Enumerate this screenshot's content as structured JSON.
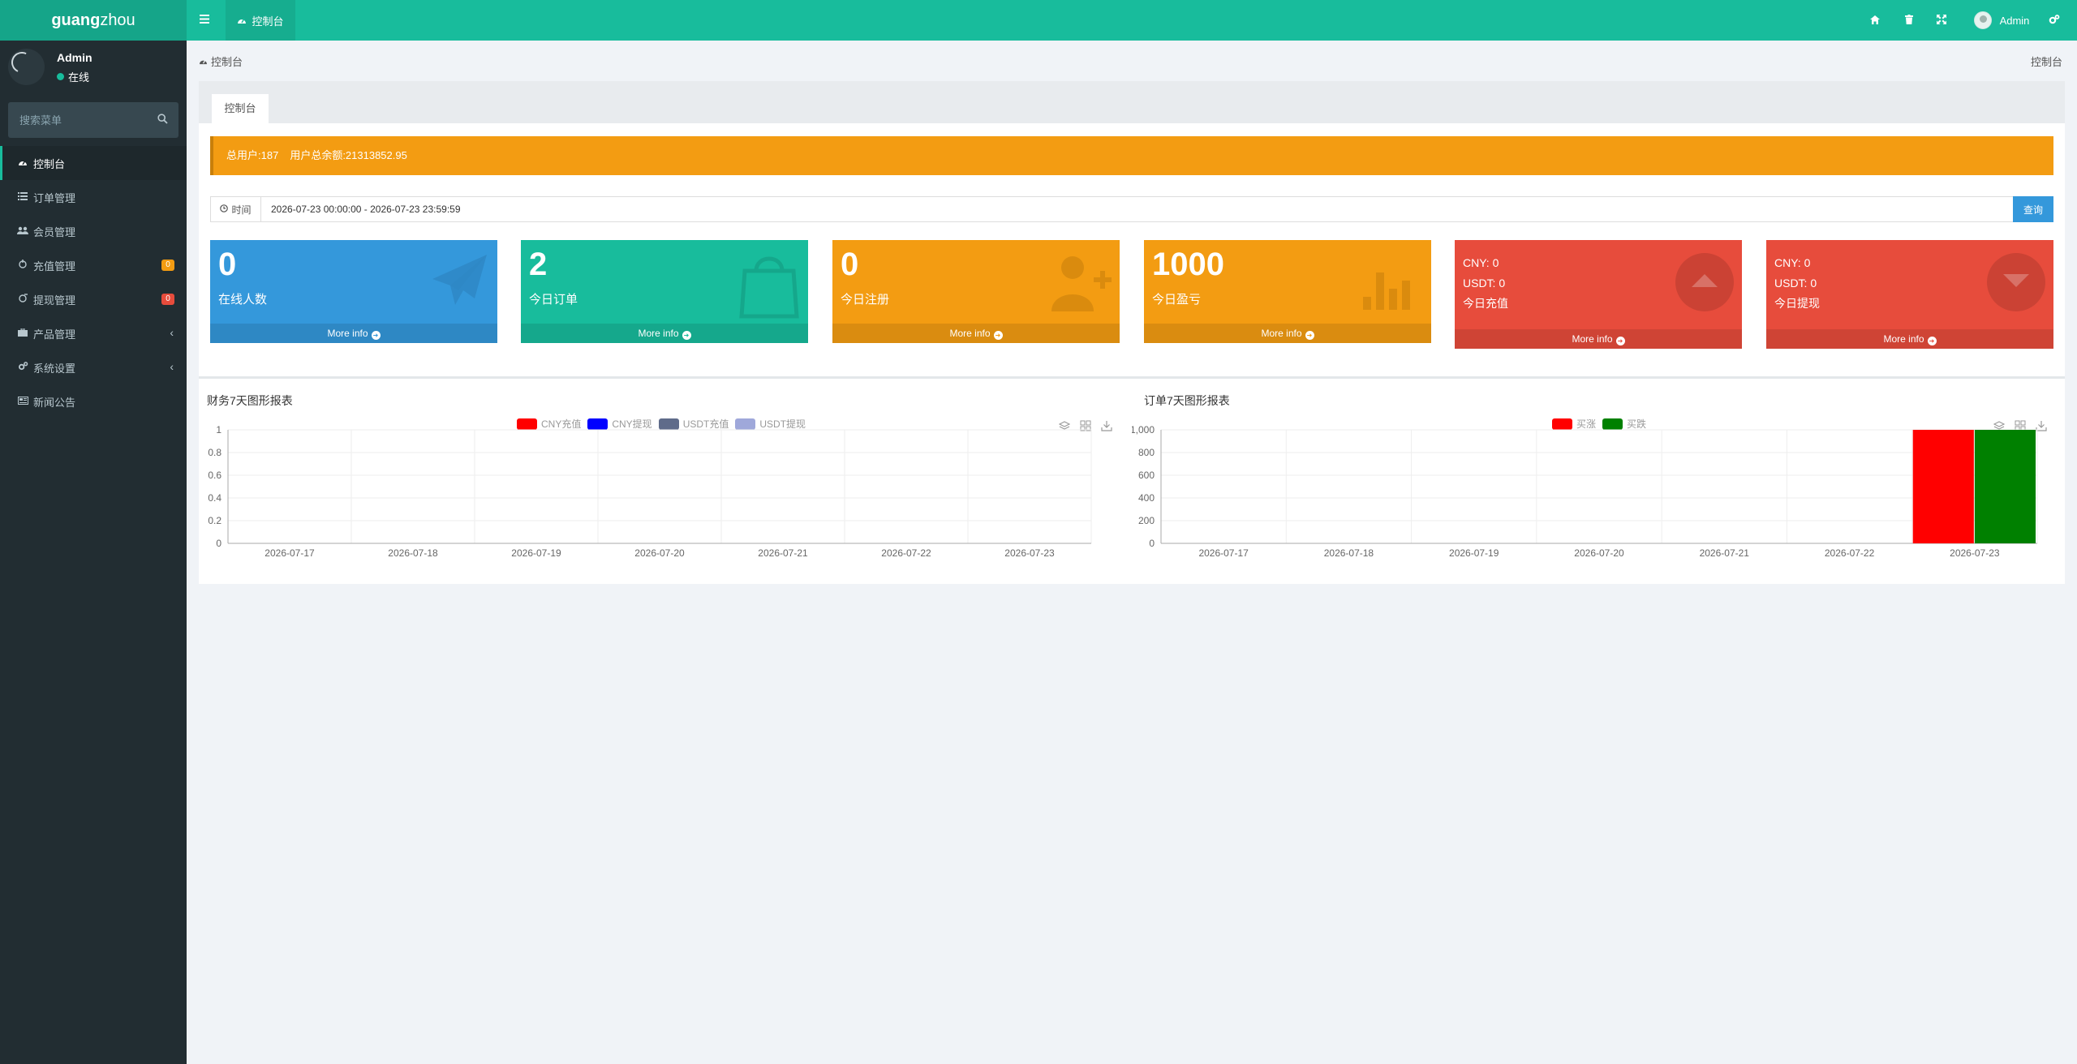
{
  "app": {
    "logo_bold": "guang",
    "logo_light": "zhou"
  },
  "header": {
    "nav_tab": "控制台",
    "user_name": "Admin"
  },
  "sidebar": {
    "user_name": "Admin",
    "status": "在线",
    "search_placeholder": "搜索菜单",
    "items": [
      {
        "label": "控制台",
        "icon": "dashboard-icon",
        "active": true
      },
      {
        "label": "订单管理",
        "icon": "list-icon"
      },
      {
        "label": "会员管理",
        "icon": "users-icon"
      },
      {
        "label": "充值管理",
        "icon": "recharge-icon",
        "badge": "0",
        "badge_color": "#f39c12"
      },
      {
        "label": "提现管理",
        "icon": "withdraw-icon",
        "badge": "0",
        "badge_color": "#e74c3c"
      },
      {
        "label": "产品管理",
        "icon": "briefcase-icon",
        "caret": "‹"
      },
      {
        "label": "系统设置",
        "icon": "cogs-icon",
        "caret": "‹"
      },
      {
        "label": "新闻公告",
        "icon": "news-icon"
      }
    ]
  },
  "breadcrumb": {
    "left": "控制台",
    "right": "控制台"
  },
  "panel": {
    "tab": "控制台",
    "alert_users": "总用户:187",
    "alert_balance": "用户总余额:21313852.95",
    "time_label": "时间",
    "time_value": "2026-07-23 00:00:00 - 2026-07-23 23:59:59",
    "query_label": "查询"
  },
  "stats": [
    {
      "value": "0",
      "label": "在线人数",
      "color": "#3498db",
      "icon": "paper-plane-icon"
    },
    {
      "value": "2",
      "label": "今日订单",
      "color": "#18bc9c",
      "icon": "shopping-bag-icon"
    },
    {
      "value": "0",
      "label": "今日注册",
      "color": "#f39c12",
      "icon": "user-plus-icon"
    },
    {
      "value": "1000",
      "label": "今日盈亏",
      "color": "#f39c12",
      "icon": "bar-chart-icon"
    },
    {
      "cny": "CNY:  0",
      "usdt": "USDT:  0",
      "label": "今日充值",
      "color": "#e74c3c",
      "icon": "arrow-up-circle-icon"
    },
    {
      "cny": "CNY:  0",
      "usdt": "USDT:  0",
      "label": "今日提现",
      "color": "#e74c3c",
      "icon": "arrow-down-circle-icon"
    }
  ],
  "more_info": "More info",
  "chart_data": [
    {
      "type": "line",
      "title": "财务7天图形报表",
      "x": [
        "2026-07-17",
        "2026-07-18",
        "2026-07-19",
        "2026-07-20",
        "2026-07-21",
        "2026-07-22",
        "2026-07-23"
      ],
      "ylim": [
        0,
        1
      ],
      "yticks": [
        "0",
        "0.2",
        "0.4",
        "0.6",
        "0.8",
        "1"
      ],
      "series": [
        {
          "name": "CNY充值",
          "color": "#ff0000",
          "values": [
            0,
            0,
            0,
            0,
            0,
            0,
            0
          ]
        },
        {
          "name": "CNY提现",
          "color": "#0000ff",
          "values": [
            0,
            0,
            0,
            0,
            0,
            0,
            0
          ]
        },
        {
          "name": "USDT充值",
          "color": "#5f6b8a",
          "values": [
            0,
            0,
            0,
            0,
            0,
            0,
            0
          ]
        },
        {
          "name": "USDT提现",
          "color": "#9fa8da",
          "values": [
            0,
            0,
            0,
            0,
            0,
            0,
            0
          ]
        }
      ],
      "legend": "top-center",
      "grid": true
    },
    {
      "type": "bar",
      "title": "订单7天图形报表",
      "x": [
        "2026-07-17",
        "2026-07-18",
        "2026-07-19",
        "2026-07-20",
        "2026-07-21",
        "2026-07-22",
        "2026-07-23"
      ],
      "ylim": [
        0,
        1000
      ],
      "yticks": [
        "0",
        "200",
        "400",
        "600",
        "800",
        "1,000"
      ],
      "series": [
        {
          "name": "买涨",
          "color": "#ff0000",
          "values": [
            0,
            0,
            0,
            0,
            0,
            0,
            1000
          ]
        },
        {
          "name": "买跌",
          "color": "#008000",
          "values": [
            0,
            0,
            0,
            0,
            0,
            0,
            1000
          ]
        }
      ],
      "legend": "top-center",
      "grid": true
    }
  ]
}
